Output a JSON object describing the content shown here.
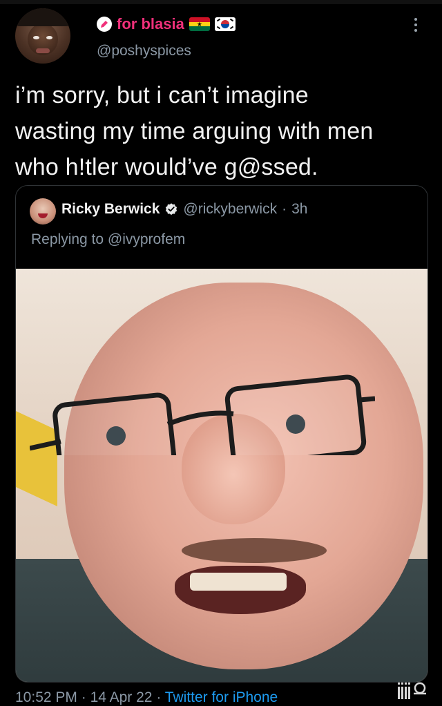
{
  "author": {
    "display_name": "for blasia",
    "handle": "@poshyspices",
    "flags": [
      "ghana-flag",
      "south-korea-flag"
    ],
    "name_color": "#f0307a"
  },
  "tweet": {
    "text": "i’m sorry, but i can’t imagine\nwasting my time arguing with men\nwho h!tler would’ve g@ssed."
  },
  "quoted": {
    "name": "Ricky Berwick",
    "handle": "@rickyberwick",
    "separator": "·",
    "age": "3h",
    "replying_to": "Replying to @ivyprofem",
    "media": "photo-close-up-man-glasses"
  },
  "footer": {
    "time": "10:52 PM",
    "date": "14 Apr 22",
    "separator": "·",
    "app": "Twitter for iPhone"
  },
  "colors": {
    "background": "#000000",
    "muted": "#8b98a5",
    "link": "#1d9bf0",
    "verified": "#e7e9ea"
  }
}
